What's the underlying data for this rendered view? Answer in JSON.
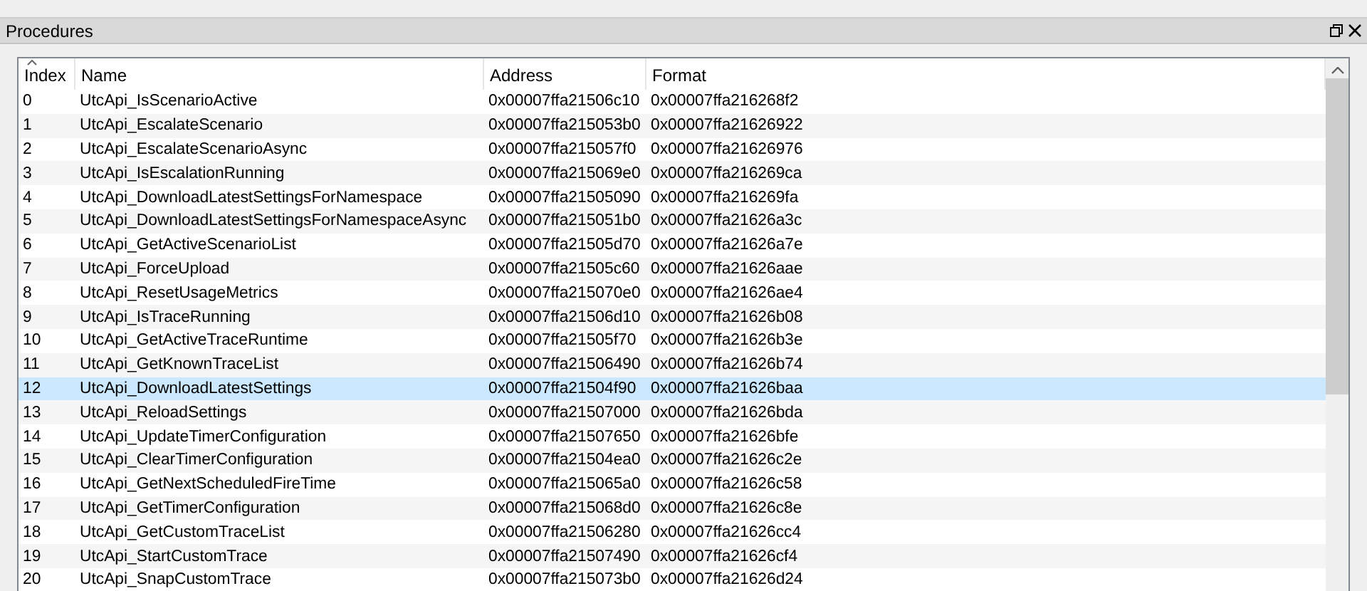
{
  "panel": {
    "title": "Procedures"
  },
  "table": {
    "columns": [
      {
        "label": "Index",
        "sorted": true
      },
      {
        "label": "Name",
        "sorted": false
      },
      {
        "label": "Address",
        "sorted": false
      },
      {
        "label": "Format",
        "sorted": false
      }
    ],
    "rows": [
      {
        "index": "0",
        "name": "UtcApi_IsScenarioActive",
        "address": "0x00007ffa21506c10",
        "format": "0x00007ffa216268f2",
        "selected": false
      },
      {
        "index": "1",
        "name": "UtcApi_EscalateScenario",
        "address": "0x00007ffa215053b0",
        "format": "0x00007ffa21626922",
        "selected": false
      },
      {
        "index": "2",
        "name": "UtcApi_EscalateScenarioAsync",
        "address": "0x00007ffa215057f0",
        "format": "0x00007ffa21626976",
        "selected": false
      },
      {
        "index": "3",
        "name": "UtcApi_IsEscalationRunning",
        "address": "0x00007ffa215069e0",
        "format": "0x00007ffa216269ca",
        "selected": false
      },
      {
        "index": "4",
        "name": "UtcApi_DownloadLatestSettingsForNamespace",
        "address": "0x00007ffa21505090",
        "format": "0x00007ffa216269fa",
        "selected": false
      },
      {
        "index": "5",
        "name": "UtcApi_DownloadLatestSettingsForNamespaceAsync",
        "address": "0x00007ffa215051b0",
        "format": "0x00007ffa21626a3c",
        "selected": false
      },
      {
        "index": "6",
        "name": "UtcApi_GetActiveScenarioList",
        "address": "0x00007ffa21505d70",
        "format": "0x00007ffa21626a7e",
        "selected": false
      },
      {
        "index": "7",
        "name": "UtcApi_ForceUpload",
        "address": "0x00007ffa21505c60",
        "format": "0x00007ffa21626aae",
        "selected": false
      },
      {
        "index": "8",
        "name": "UtcApi_ResetUsageMetrics",
        "address": "0x00007ffa215070e0",
        "format": "0x00007ffa21626ae4",
        "selected": false
      },
      {
        "index": "9",
        "name": "UtcApi_IsTraceRunning",
        "address": "0x00007ffa21506d10",
        "format": "0x00007ffa21626b08",
        "selected": false
      },
      {
        "index": "10",
        "name": "UtcApi_GetActiveTraceRuntime",
        "address": "0x00007ffa21505f70",
        "format": "0x00007ffa21626b3e",
        "selected": false
      },
      {
        "index": "11",
        "name": "UtcApi_GetKnownTraceList",
        "address": "0x00007ffa21506490",
        "format": "0x00007ffa21626b74",
        "selected": false
      },
      {
        "index": "12",
        "name": "UtcApi_DownloadLatestSettings",
        "address": "0x00007ffa21504f90",
        "format": "0x00007ffa21626baa",
        "selected": true
      },
      {
        "index": "13",
        "name": "UtcApi_ReloadSettings",
        "address": "0x00007ffa21507000",
        "format": "0x00007ffa21626bda",
        "selected": false
      },
      {
        "index": "14",
        "name": "UtcApi_UpdateTimerConfiguration",
        "address": "0x00007ffa21507650",
        "format": "0x00007ffa21626bfe",
        "selected": false
      },
      {
        "index": "15",
        "name": "UtcApi_ClearTimerConfiguration",
        "address": "0x00007ffa21504ea0",
        "format": "0x00007ffa21626c2e",
        "selected": false
      },
      {
        "index": "16",
        "name": "UtcApi_GetNextScheduledFireTime",
        "address": "0x00007ffa215065a0",
        "format": "0x00007ffa21626c58",
        "selected": false
      },
      {
        "index": "17",
        "name": "UtcApi_GetTimerConfiguration",
        "address": "0x00007ffa215068d0",
        "format": "0x00007ffa21626c8e",
        "selected": false
      },
      {
        "index": "18",
        "name": "UtcApi_GetCustomTraceList",
        "address": "0x00007ffa21506280",
        "format": "0x00007ffa21626cc4",
        "selected": false
      },
      {
        "index": "19",
        "name": "UtcApi_StartCustomTrace",
        "address": "0x00007ffa21507490",
        "format": "0x00007ffa21626cf4",
        "selected": false
      },
      {
        "index": "20",
        "name": "UtcApi_SnapCustomTrace",
        "address": "0x00007ffa215073b0",
        "format": "0x00007ffa21626d24",
        "selected": false
      }
    ]
  }
}
